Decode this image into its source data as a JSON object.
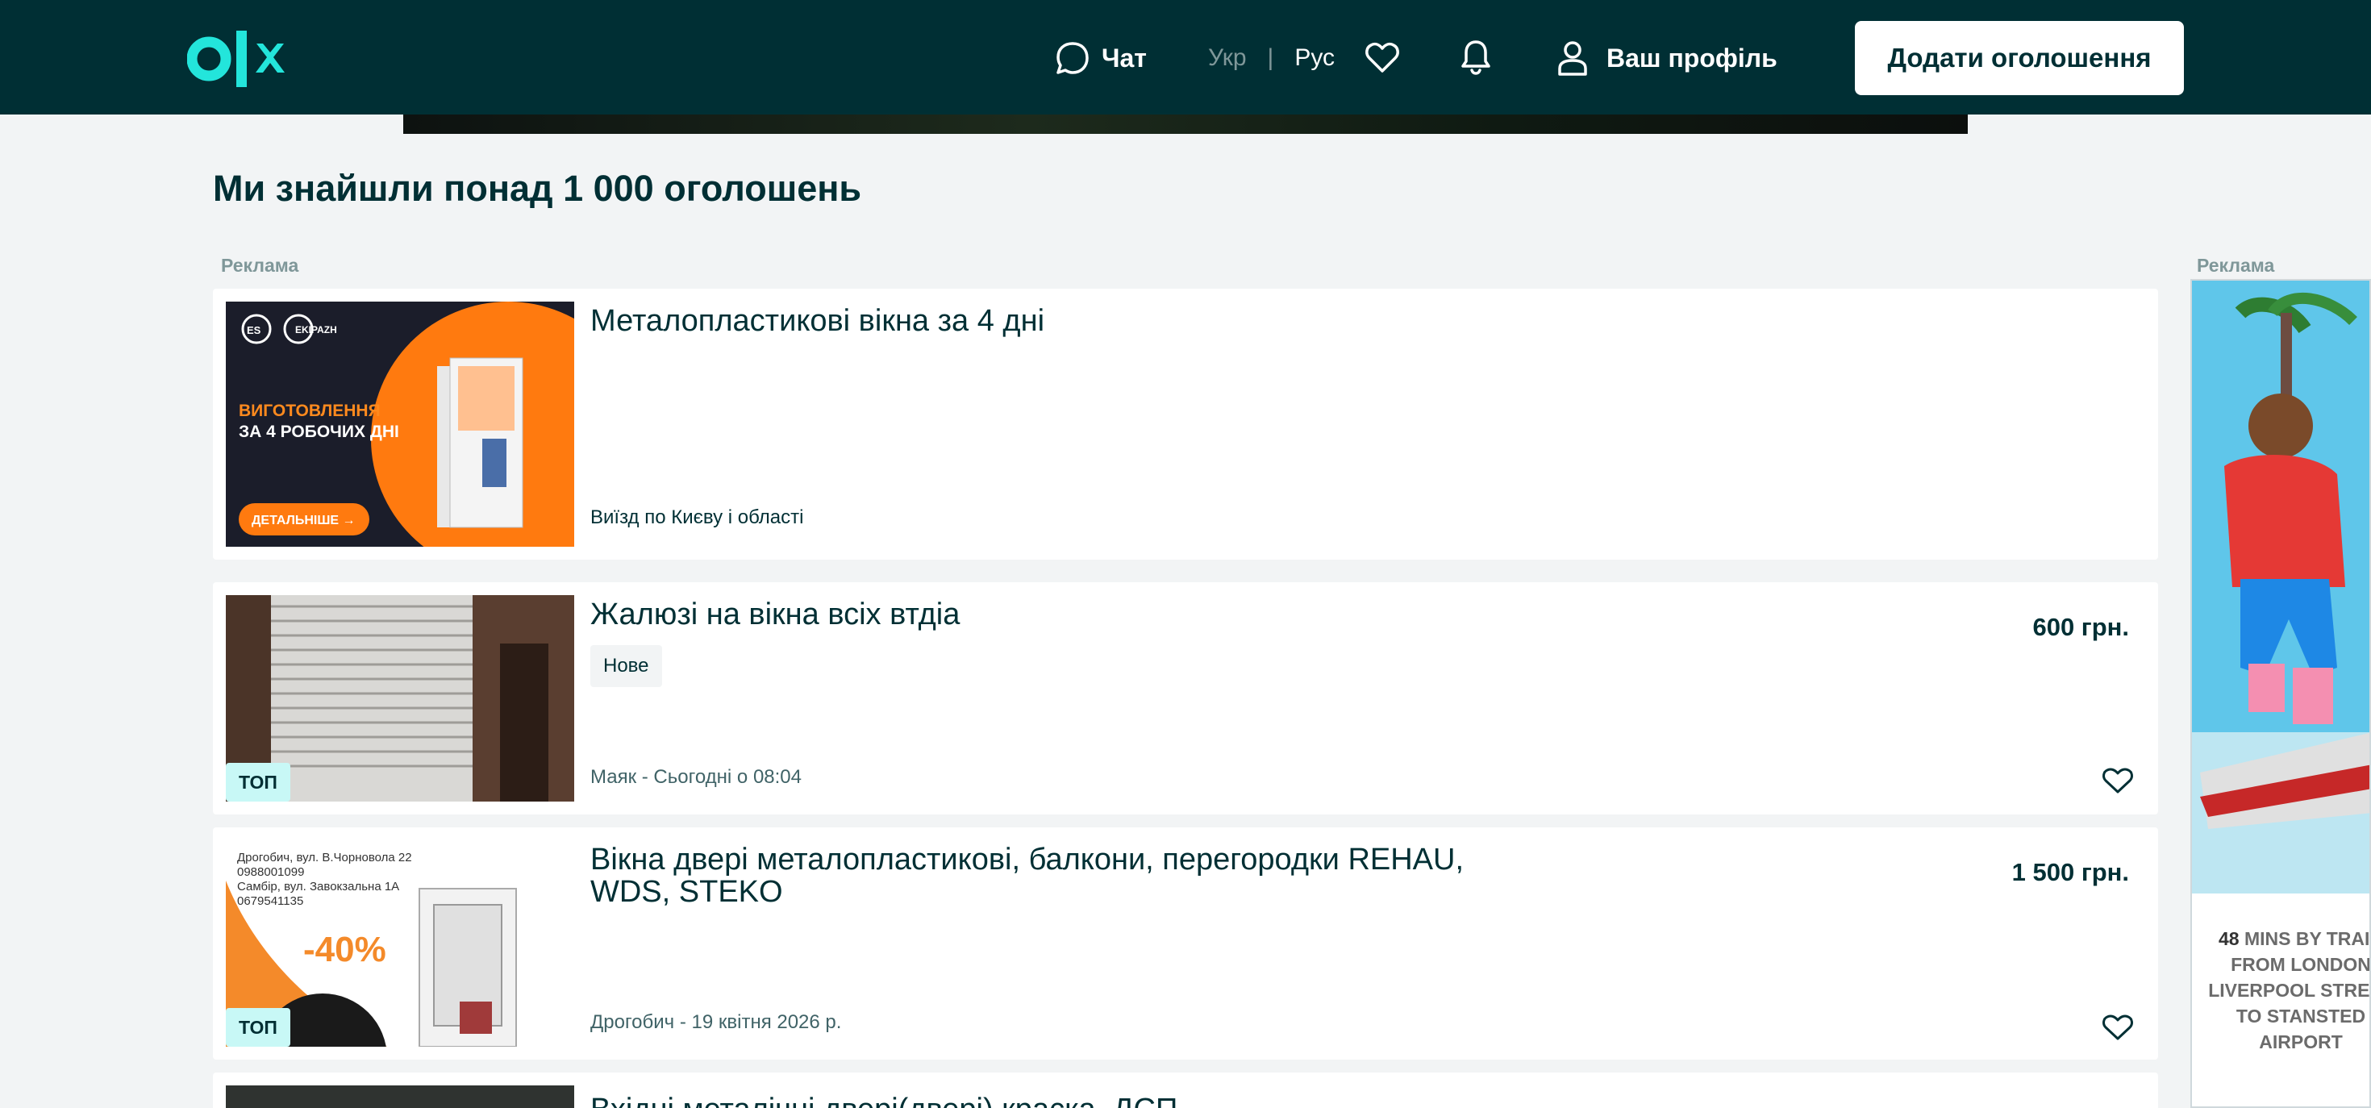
{
  "header": {
    "chat_label": "Чат",
    "lang_ukr": "Укр",
    "lang_sep": "|",
    "lang_rus": "Рус",
    "profile_label": "Ваш профіль",
    "add_button_label": "Додати оголошення"
  },
  "main": {
    "title": "Ми знайшли понад 1 000 оголошень",
    "ad_label": "Реклама"
  },
  "ad_card": {
    "title": "Металопластикові вікна за 4 дні",
    "meta": "Виїзд по Києву і області",
    "image": {
      "brand_es": "ES",
      "brand_ekipazh": "EKIPAZH",
      "line1": "ВИГОТОВЛЕННЯ",
      "line2": "ЗА 4 РОБОЧИХ ДНІ",
      "cta": "ДЕТАЛЬНІШЕ →"
    }
  },
  "listings": [
    {
      "title": "Жалюзі на вікна всіх втдіа",
      "condition": "Нове",
      "price": "600 грн.",
      "meta": "Маяк - Сьогодні о 08:04",
      "badge": "ТОП"
    },
    {
      "title_line1": "Вікна двері металопластикові, балкони, перегородки REHAU,",
      "title_line2": "WDS, STEKO",
      "price": "1 500 грн.",
      "meta": "Дрогобич - 19 квітня 2026 р.",
      "badge": "ТОП",
      "image": {
        "addr1": "Дрогобич, вул. В.Чорновола 22",
        "phone1": "0988001099",
        "addr2": "Самбір, вул. Завокзальна  1А",
        "phone2": "0679541135",
        "discount": "-40%"
      }
    },
    {
      "title": "Вхідні металічні двері(двері) краска, ДСП"
    }
  ],
  "side_ad": {
    "label": "Реклама",
    "text_bold": "48",
    "text": "MINS BY TRAIN FROM LONDON LIVERPOOL STREET TO STANSTED AIRPORT"
  },
  "colors": {
    "header_bg": "#002f34",
    "brand_teal": "#23e5db",
    "page_bg": "#f2f4f5",
    "top_badge": "#c8f8f6"
  }
}
